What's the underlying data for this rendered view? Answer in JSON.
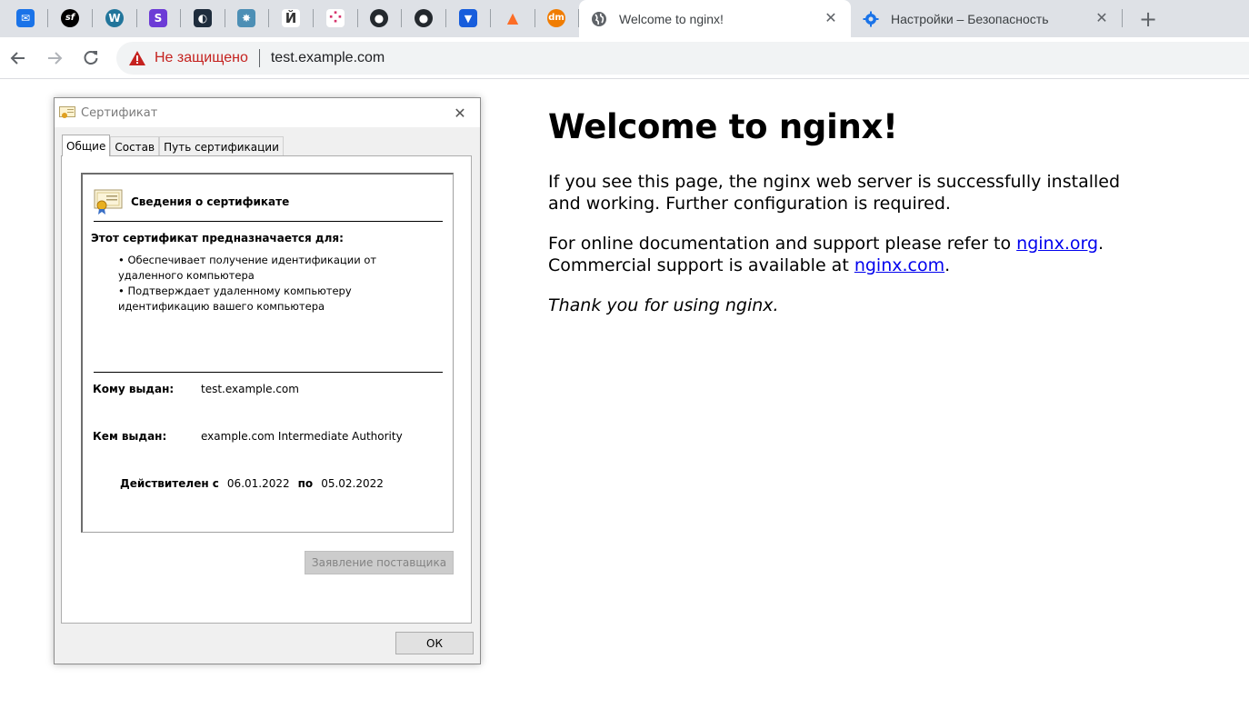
{
  "browser": {
    "pinned_tabs": [
      {
        "icon": "mail-icon",
        "color": "#1a73e8",
        "glyph": "✉"
      },
      {
        "icon": "symfony-icon",
        "color": "#000000",
        "glyph": "sf"
      },
      {
        "icon": "wordpress-icon",
        "color": "#21759b",
        "glyph": "W"
      },
      {
        "icon": "s-app-icon",
        "color": "#6c3bd6",
        "glyph": "S"
      },
      {
        "icon": "docker-like-icon",
        "color": "#1f2d3d",
        "glyph": "◐"
      },
      {
        "icon": "puzzle-icon",
        "color": "#4d8fb5",
        "glyph": "✸"
      },
      {
        "icon": "letter-h-icon",
        "color": "#ffffff",
        "glyph": "Й"
      },
      {
        "icon": "dots-icon",
        "color": "#ffffff",
        "glyph": "⁘"
      },
      {
        "icon": "github-icon",
        "color": "#24292e",
        "glyph": "●"
      },
      {
        "icon": "github-icon",
        "color": "#24292e",
        "glyph": "●"
      },
      {
        "icon": "bitwarden-icon",
        "color": "#175ddc",
        "glyph": "▼"
      },
      {
        "icon": "gitlab-icon",
        "color": "#fc6d26",
        "glyph": "▲"
      },
      {
        "icon": "dm-icon",
        "color": "#f07c00",
        "glyph": "dm"
      }
    ],
    "tabs": [
      {
        "title": "Welcome to nginx!",
        "active": true,
        "icon": "globe-icon"
      },
      {
        "title": "Настройки – Безопасность",
        "active": false,
        "icon": "gear-icon"
      }
    ],
    "new_tab_label": "+",
    "close_glyph": "✕",
    "omnibox": {
      "security_label": "Не защищено",
      "url": "test.example.com"
    }
  },
  "page": {
    "heading": "Welcome to nginx!",
    "para1": "If you see this page, the nginx web server is successfully installed and working. Further configuration is required.",
    "para2_prefix": "For online documentation and support please refer to ",
    "link1": "nginx.org",
    "para2_mid": ".",
    "para2_line2_prefix": "Commercial support is available at ",
    "link2": "nginx.com",
    "para2_suffix": ".",
    "thanks": "Thank you for using nginx."
  },
  "dialog": {
    "title": "Сертификат",
    "tabs": [
      "Общие",
      "Состав",
      "Путь сертификации"
    ],
    "info_header": "Сведения о сертификате",
    "purpose_header": "Этот сертификат предназначается для:",
    "purposes": [
      "• Обеспечивает получение идентификации от удаленного компьютера",
      "• Подтверждает удаленному компьютеру идентификацию вашего компьютера"
    ],
    "issued_to_label": "Кому выдан:",
    "issued_to": "test.example.com",
    "issued_by_label": "Кем выдан:",
    "issued_by": "example.com Intermediate Authority",
    "valid_from_label": "Действителен с",
    "valid_from": "06.01.2022",
    "valid_to_label": "по",
    "valid_to": "05.02.2022",
    "issuer_statement_button": "Заявление поставщика",
    "ok_button": "ОК"
  }
}
